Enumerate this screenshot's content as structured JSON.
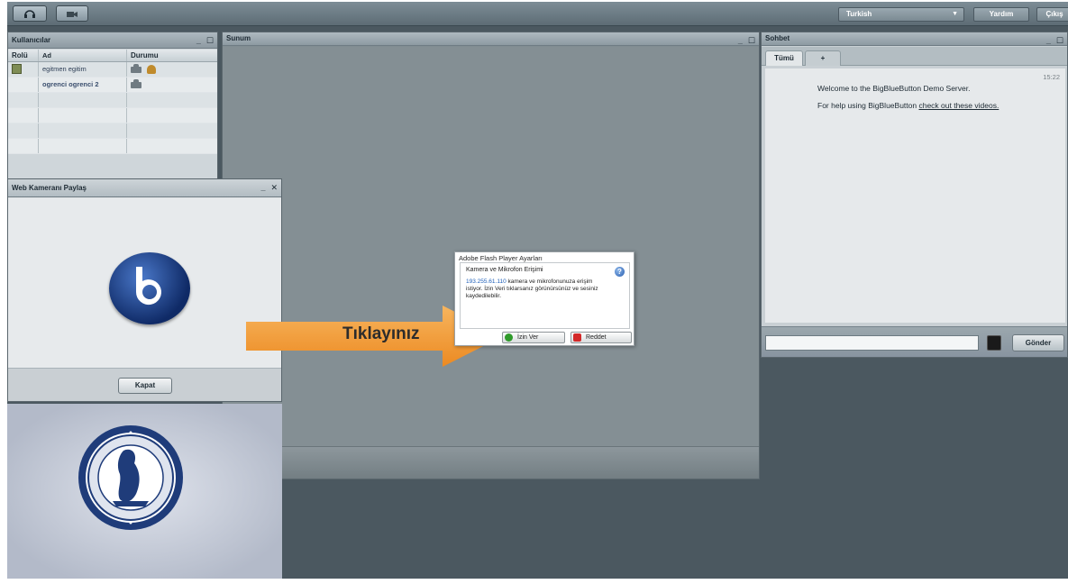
{
  "topbar": {
    "home_icon": "headset-icon",
    "second_icon": "webcam-icon",
    "language": "Turkish",
    "help_label": "Yardım",
    "logout_label": "Çıkış"
  },
  "users": {
    "title": "Kullanıcılar",
    "columns": [
      "Rolü",
      "Ad",
      "Durumu"
    ],
    "rows": [
      {
        "name": "egitmen egitim"
      },
      {
        "name": "ogrenci ogrenci 2"
      }
    ]
  },
  "webcam": {
    "title": "Web Kameranı Paylaş",
    "close_label": "Kapat"
  },
  "presentation": {
    "title": "Sunum"
  },
  "chat": {
    "title": "Sohbet",
    "tabs": [
      "Tümü",
      "+"
    ],
    "time": "15:22",
    "welcome": "Welcome to the BigBlueButton Demo Server.",
    "help_prefix": "For help using BigBlueButton ",
    "help_link": "check out these videos.",
    "send_label": "Gönder"
  },
  "flash_dialog": {
    "title": "Adobe Flash Player Ayarları",
    "heading": "Kamera ve Mikrofon Erişimi",
    "ip": "193.255.61.110",
    "body": " kamera ve mikrofonunuza erişim istiyor. İzin Veri tıklarsanız görünürsünüz ve sesiniz kaydedilebilir.",
    "allow_label": "İzin Ver",
    "deny_label": "Reddet"
  },
  "annotation": {
    "label": "Tıklayınız",
    "color": "#f0952e"
  }
}
